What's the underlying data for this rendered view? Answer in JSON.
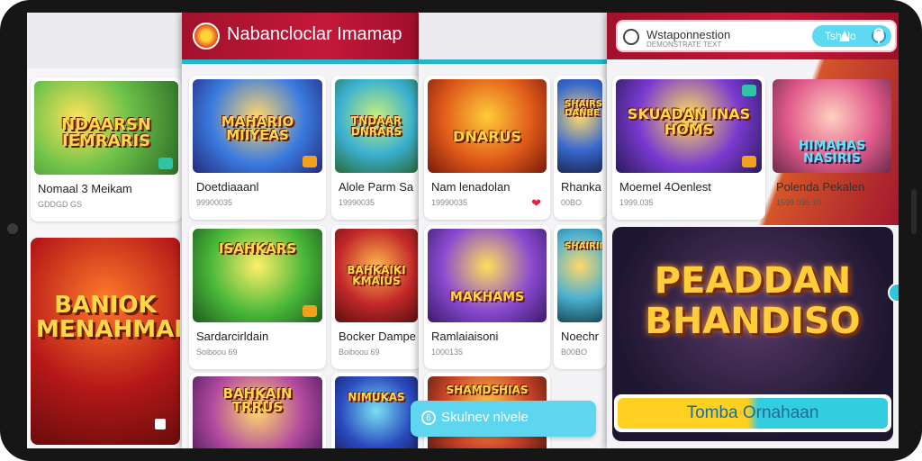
{
  "app": {
    "title": "Nabancloclar Imamap"
  },
  "search": {
    "text": "Wstaponnestion",
    "sub": "DEMONSTRATE TEXT",
    "button": "Tshelo"
  },
  "colors": {
    "header": "#b3142f",
    "accent": "#22b8c9"
  },
  "icons": {
    "back": "back-arrow-icon",
    "game_controller": "controller-icon",
    "notifications": "bell-icon",
    "search": "search-icon"
  },
  "panel1": {
    "cards": [
      {
        "caption": "NDAARSN IEMRARIS",
        "tag": "",
        "name": "Nomaal 3 Meikam",
        "sub": "GDDGD GS"
      }
    ],
    "banner": {
      "caption": "BANIOK MENAHMAH"
    }
  },
  "panel2": {
    "cards": [
      {
        "caption": "MAHARIO MIIYEAS",
        "tag": "",
        "name": "Doetdiaaanl",
        "sub": "99900035"
      },
      {
        "caption": "ISAHKARS",
        "tag": "",
        "name": "Sardarcirldain",
        "sub": "Soiboou 69"
      },
      {
        "caption": "BAHKAIN TRRUS",
        "tag": "",
        "name": "",
        "sub": ""
      }
    ],
    "cards2": [
      {
        "caption": "TNDAAR DNRARS",
        "tag": "",
        "name": "Alole Parm Sa",
        "sub": "19990035"
      },
      {
        "caption": "BAHKAIKI KMAIUS",
        "tag": "",
        "name": "Bocker Dampe",
        "sub": "Boiboou 69"
      },
      {
        "caption": "NIMUKAS",
        "tag": "",
        "name": "",
        "sub": ""
      }
    ]
  },
  "panel3": {
    "cards": [
      {
        "caption": "DNARUS",
        "tag": "",
        "name": "Nam lenadolan",
        "sub": "19990035"
      },
      {
        "caption": "MAKHAMS",
        "tag": "",
        "name": "Ramlaiaisoni",
        "sub": "1000135"
      },
      {
        "caption": "SHAMDSHIAS",
        "tag": "",
        "name": "",
        "sub": ""
      }
    ],
    "cards2": [
      {
        "caption": "SHAIRS DANBE",
        "tag": "",
        "name": "Rhanka",
        "sub": "00BO"
      },
      {
        "caption": "SHAIRIIN",
        "tag": "",
        "name": "Noechr",
        "sub": "B00BO"
      }
    ],
    "toast": "Skulnev nlvele"
  },
  "panel4": {
    "cards": [
      {
        "caption": "SKUADAN INAS HOMS",
        "tag": "",
        "name": "Moemel 4Oenlest",
        "sub": "1999.035"
      },
      {
        "caption": "HIMAHAS NASIRIS",
        "tag": "",
        "name": "Polenda Pekalen",
        "sub": "1599.035 10"
      }
    ],
    "promo": {
      "caption": "PEADDAN BHANDISO",
      "button": "Tomba Ornahaan"
    }
  }
}
